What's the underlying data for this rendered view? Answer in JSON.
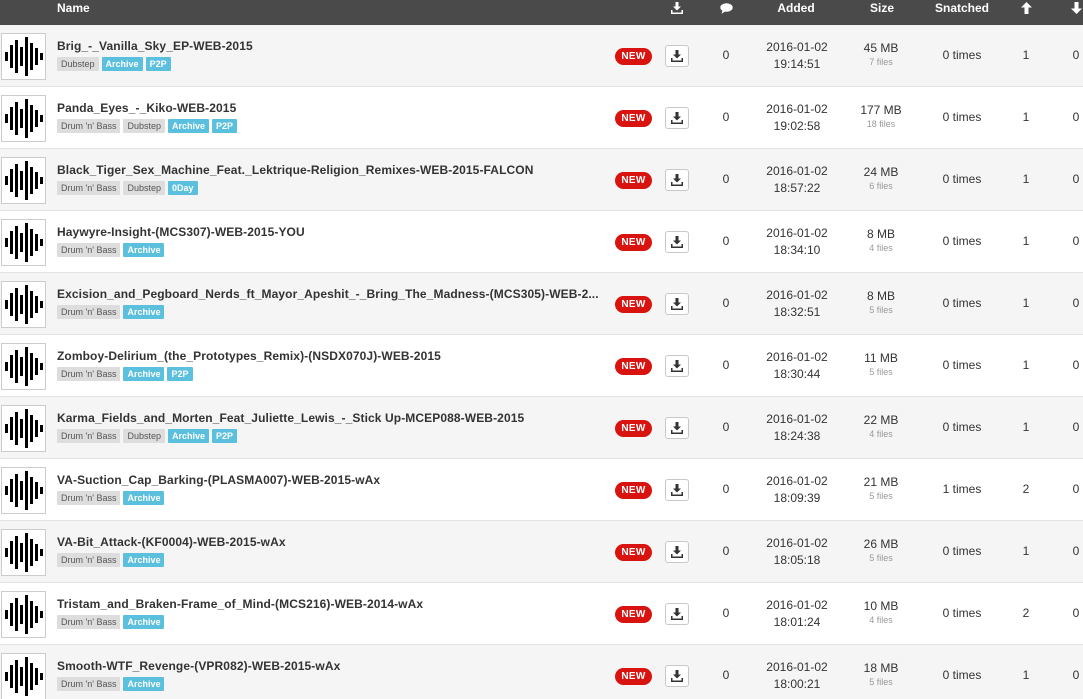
{
  "header": {
    "name": "Name",
    "download_icon": "download-icon",
    "comments_icon": "comment-icon",
    "added": "Added",
    "size": "Size",
    "snatched": "Snatched",
    "seeders_icon": "arrow-up-icon",
    "leechers_icon": "arrow-down-icon"
  },
  "badge_new": "NEW",
  "colors": {
    "header_bg": "#4a4a4a",
    "new_badge": "#d9130f",
    "source_tag": "#5bc0de",
    "genre_tag": "#dddddd"
  },
  "rows": [
    {
      "title": "Brig_-_Vanilla_Sky_EP-WEB-2015",
      "genres": [
        "Dubstep"
      ],
      "sources": [
        "Archive",
        "P2P"
      ],
      "comments": "0",
      "date": "2016-01-02",
      "time": "19:14:51",
      "size": "45 MB",
      "files": "7 files",
      "snatched": "0 times",
      "seeders": "1",
      "leechers": "0"
    },
    {
      "title": "Panda_Eyes_-_Kiko-WEB-2015",
      "genres": [
        "Drum 'n' Bass",
        "Dubstep"
      ],
      "sources": [
        "Archive",
        "P2P"
      ],
      "comments": "0",
      "date": "2016-01-02",
      "time": "19:02:58",
      "size": "177 MB",
      "files": "18 files",
      "snatched": "0 times",
      "seeders": "1",
      "leechers": "0"
    },
    {
      "title": "Black_Tiger_Sex_Machine_Feat._Lektrique-Religion_Remixes-WEB-2015-FALCON",
      "genres": [
        "Drum 'n' Bass",
        "Dubstep"
      ],
      "sources": [
        "0Day"
      ],
      "comments": "0",
      "date": "2016-01-02",
      "time": "18:57:22",
      "size": "24 MB",
      "files": "6 files",
      "snatched": "0 times",
      "seeders": "1",
      "leechers": "0"
    },
    {
      "title": "Haywyre-Insight-(MCS307)-WEB-2015-YOU",
      "genres": [
        "Drum 'n' Bass"
      ],
      "sources": [
        "Archive"
      ],
      "comments": "0",
      "date": "2016-01-02",
      "time": "18:34:10",
      "size": "8 MB",
      "files": "4 files",
      "snatched": "0 times",
      "seeders": "1",
      "leechers": "0"
    },
    {
      "title": "Excision_and_Pegboard_Nerds_ft_Mayor_Apeshit_-_Bring_The_Madness-(MCS305)-WEB-2...",
      "genres": [
        "Drum 'n' Bass"
      ],
      "sources": [
        "Archive"
      ],
      "comments": "0",
      "date": "2016-01-02",
      "time": "18:32:51",
      "size": "8 MB",
      "files": "5 files",
      "snatched": "0 times",
      "seeders": "1",
      "leechers": "0"
    },
    {
      "title": "Zomboy-Delirium_(the_Prototypes_Remix)-(NSDX070J)-WEB-2015",
      "genres": [
        "Drum 'n' Bass"
      ],
      "sources": [
        "Archive",
        "P2P"
      ],
      "comments": "0",
      "date": "2016-01-02",
      "time": "18:30:44",
      "size": "11 MB",
      "files": "5 files",
      "snatched": "0 times",
      "seeders": "1",
      "leechers": "0"
    },
    {
      "title": "Karma_Fields_and_Morten_Feat_Juliette_Lewis_-_Stick Up-MCEP088-WEB-2015",
      "genres": [
        "Drum 'n' Bass",
        "Dubstep"
      ],
      "sources": [
        "Archive",
        "P2P"
      ],
      "comments": "0",
      "date": "2016-01-02",
      "time": "18:24:38",
      "size": "22 MB",
      "files": "4 files",
      "snatched": "0 times",
      "seeders": "1",
      "leechers": "0"
    },
    {
      "title": "VA-Suction_Cap_Barking-(PLASMA007)-WEB-2015-wAx",
      "genres": [
        "Drum 'n' Bass"
      ],
      "sources": [
        "Archive"
      ],
      "comments": "0",
      "date": "2016-01-02",
      "time": "18:09:39",
      "size": "21 MB",
      "files": "5 files",
      "snatched": "1 times",
      "seeders": "2",
      "leechers": "0"
    },
    {
      "title": "VA-Bit_Attack-(KF0004)-WEB-2015-wAx",
      "genres": [
        "Drum 'n' Bass"
      ],
      "sources": [
        "Archive"
      ],
      "comments": "0",
      "date": "2016-01-02",
      "time": "18:05:18",
      "size": "26 MB",
      "files": "5 files",
      "snatched": "0 times",
      "seeders": "1",
      "leechers": "0"
    },
    {
      "title": "Tristam_and_Braken-Frame_of_Mind-(MCS216)-WEB-2014-wAx",
      "genres": [
        "Drum 'n' Bass"
      ],
      "sources": [
        "Archive"
      ],
      "comments": "0",
      "date": "2016-01-02",
      "time": "18:01:24",
      "size": "10 MB",
      "files": "4 files",
      "snatched": "0 times",
      "seeders": "2",
      "leechers": "0"
    },
    {
      "title": "Smooth-WTF_Revenge-(VPR082)-WEB-2015-wAx",
      "genres": [
        "Drum 'n' Bass"
      ],
      "sources": [
        "Archive"
      ],
      "comments": "0",
      "date": "2016-01-02",
      "time": "18:00:21",
      "size": "18 MB",
      "files": "5 files",
      "snatched": "0 times",
      "seeders": "1",
      "leechers": "0"
    }
  ]
}
